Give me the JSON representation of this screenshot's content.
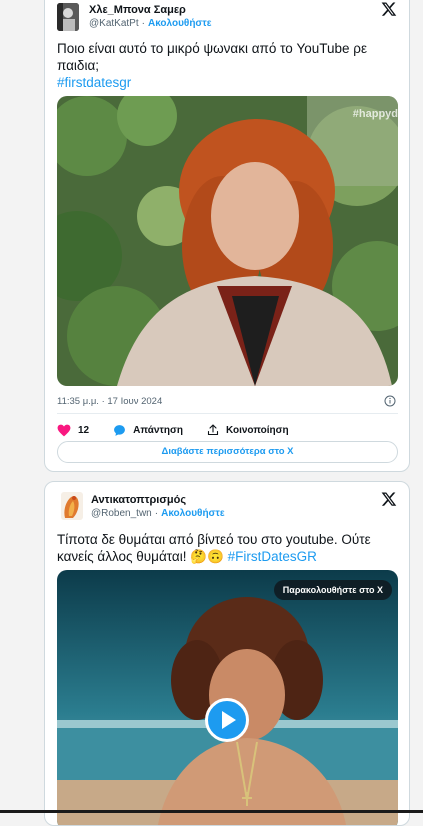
{
  "tweets": [
    {
      "display_name": "Χλε_Μπονα Σαμερ",
      "handle": "@KatKatPt",
      "separator": "·",
      "follow_label": "Ακολουθήστε",
      "text": "Ποιο είναι αυτό το μικρό ψωνακι από το YouTube ρε παιδια;",
      "hashtag": "#firstdatesgr",
      "media_watermark": "#happyd",
      "timestamp": "11:35 μ.μ. · 17 Ιουν 2024",
      "like_count": "12",
      "reply_label": "Απάντηση",
      "share_label": "Κοινοποίηση",
      "read_more_label": "Διαβάστε περισσότερα στο X",
      "like_color": "#f91880"
    },
    {
      "display_name": "Αντικατοπτρισμός",
      "handle": "@Roben_twn",
      "separator": "·",
      "follow_label": "Ακολουθήστε",
      "text": "Τίποτα δε θυμάται από βίντεό του στο youtube. Ούτε κανείς άλλος θυμάται! 🤔🙃",
      "hashtag": "#FirstDatesGR",
      "watch_label": "Παρακολουθήστε στο X"
    }
  ],
  "colors": {
    "accent": "#1d9bf0",
    "text": "#0f1419",
    "muted": "#536471",
    "border": "#cfd9de"
  }
}
